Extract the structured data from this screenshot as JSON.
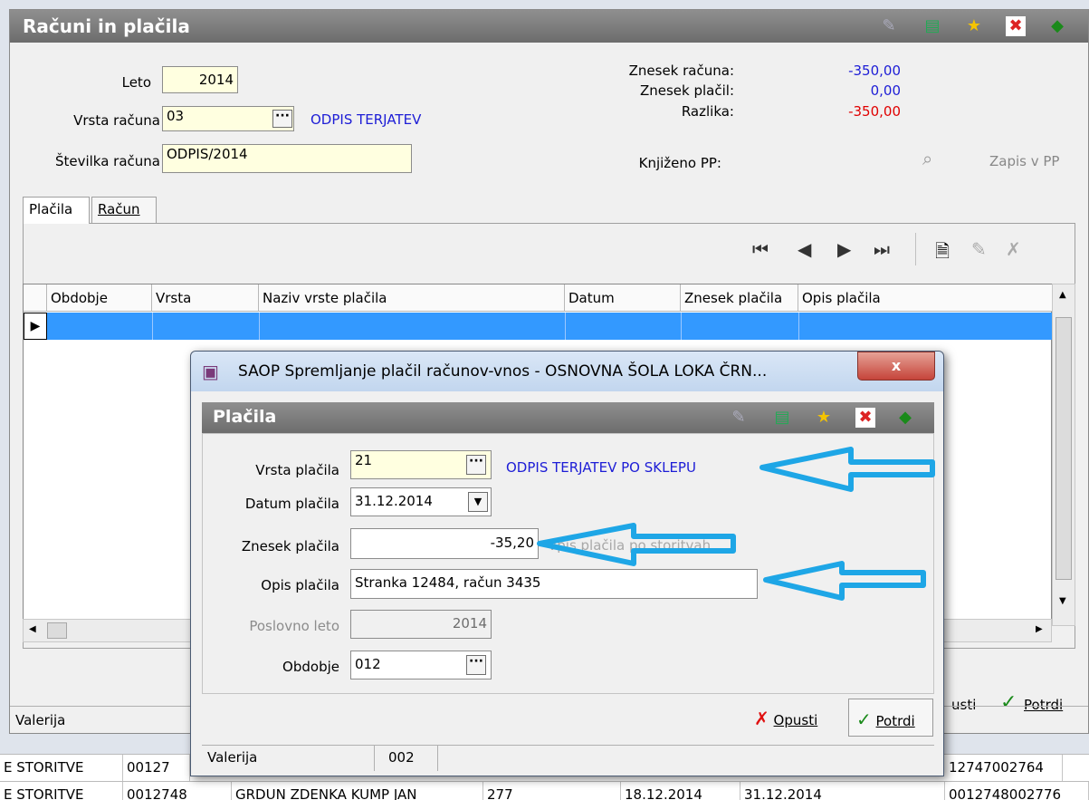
{
  "main": {
    "title": "Računi in plačila",
    "leto_label": "Leto",
    "leto_value": "2014",
    "vrsta_racuna_label": "Vrsta računa",
    "vrsta_racuna_value": "03",
    "vrsta_racuna_desc": "ODPIS TERJATEV",
    "stevilka_label": "Številka računa",
    "stevilka_value": "ODPIS/2014",
    "znesek_racuna_label": "Znesek računa:",
    "znesek_racuna_value": "-350,00",
    "znesek_placil_label": "Znesek plačil:",
    "znesek_placil_value": "0,00",
    "razlika_label": "Razlika:",
    "razlika_value": "-350,00",
    "knjizeno_label": "Knjiženo PP:",
    "zapis_label": "Zapis v PP",
    "tabs": [
      {
        "label": "Plačila"
      },
      {
        "label": "Račun"
      }
    ],
    "columns": [
      "Obdobje",
      "Vrsta",
      "Naziv vrste plačila",
      "Datum",
      "Znesek plačila",
      "Opis plačila"
    ],
    "opusti": "usti",
    "potrdi": "Potrdi",
    "status_user": "Valerija"
  },
  "strip_rows": [
    [
      "E STORITVE",
      "00127",
      "",
      "",
      "",
      "",
      "12747002764"
    ],
    [
      "E STORITVE",
      "0012748",
      "GRDUN ZDENKA KUMP JAN",
      "277",
      "18.12.2014",
      "31.12.2014",
      "0012748002776"
    ]
  ],
  "dialog": {
    "window_title": "SAOP Spremljanje plačil računov-vnos - OSNOVNA ŠOLA LOKA ČRN...",
    "close": "x",
    "title": "Plačila",
    "vrsta_placila_label": "Vrsta plačila",
    "vrsta_placila_value": "21",
    "vrsta_placila_desc": "ODPIS TERJATEV PO SKLEPU",
    "datum_label": "Datum plačila",
    "datum_value": "31.12.2014",
    "znesek_label": "Znesek plačila",
    "znesek_value": "-35,20",
    "znesek_hint": "Vpis plačila po storitvah",
    "opis_label": "Opis plačila",
    "opis_value": "Stranka 12484, račun 3435",
    "poslovno_label": "Poslovno leto",
    "poslovno_value": "2014",
    "obdobje_label": "Obdobje",
    "obdobje_value": "012",
    "opusti": "Opusti",
    "potrdi": "Potrdi",
    "status_user": "Valerija",
    "status_code": "002"
  },
  "colors": {
    "selection": "#3399ff",
    "amount_red": "#e00000",
    "amount_blue": "#1d1dd6",
    "annotation_arrow": "#1ea6e6"
  }
}
